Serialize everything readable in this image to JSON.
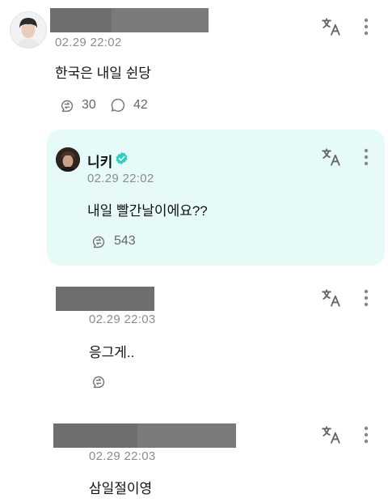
{
  "comments": [
    {
      "timestamp": "02.29 22:02",
      "text": "한국은 내일 쉰당",
      "repost_count": "30",
      "reply_count": "42"
    },
    {
      "author": "니키",
      "verified": true,
      "timestamp": "02.29 22:02",
      "text": "내일 빨간날이에요??",
      "repost_count": "543"
    },
    {
      "timestamp": "02.29 22:03",
      "text": "응그게.."
    },
    {
      "timestamp": "02.29 22:03",
      "text": "삼일절이영"
    }
  ],
  "colors": {
    "highlight_bg": "#e6fbf7",
    "verified_badge": "#2ad0c0",
    "redaction": "#6f6f6f",
    "secondary_text": "#8c8c8c"
  },
  "icons": [
    "translate-icon",
    "more-vertical-icon",
    "repost-icon",
    "reply-icon",
    "verified-badge-icon"
  ]
}
